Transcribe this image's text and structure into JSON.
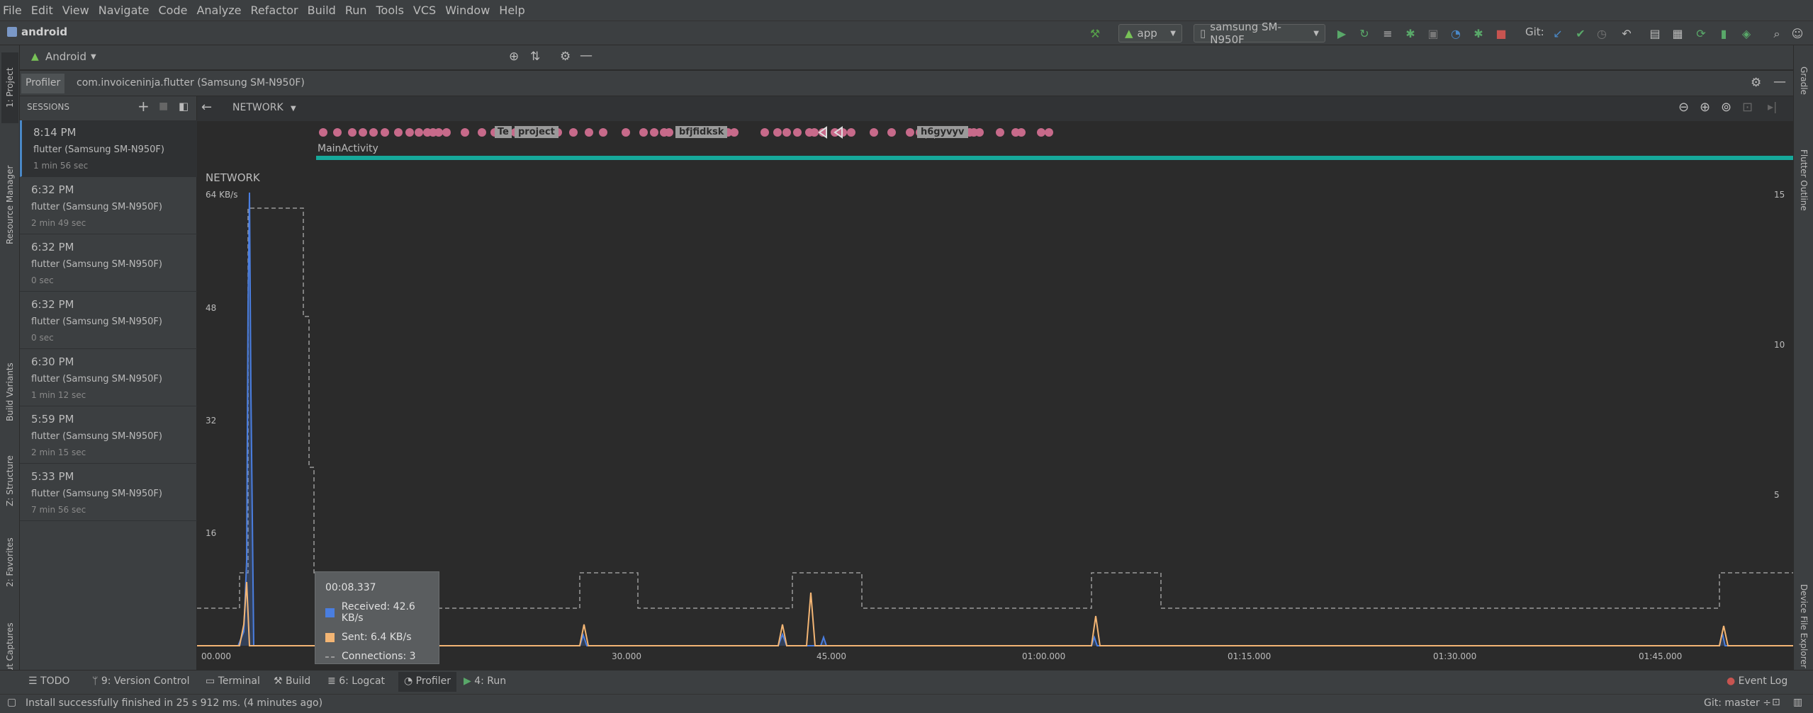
{
  "menu": [
    "File",
    "Edit",
    "View",
    "Navigate",
    "Code",
    "Analyze",
    "Refactor",
    "Build",
    "Run",
    "Tools",
    "VCS",
    "Window",
    "Help"
  ],
  "toolbar": {
    "project_name": "android",
    "run_config": "app",
    "device": "samsung SM-N950F",
    "git_label": "Git:"
  },
  "project_panel": {
    "selector": "Android"
  },
  "left_tabs": [
    "1: Project",
    "Resource Manager",
    "Build Variants",
    "Z: Structure",
    "2: Favorites",
    "Layout Captures"
  ],
  "right_tabs": [
    "Gradle",
    "Flutter Outline",
    "Device File Explorer"
  ],
  "profiler_tabs": {
    "profiler": "Profiler",
    "process": "com.invoiceninja.flutter (Samsung SM-N950F)"
  },
  "sessions": {
    "header": "SESSIONS",
    "items": [
      {
        "time": "8:14 PM",
        "device": "flutter (Samsung SM-N950F)",
        "length": "1 min 56 sec"
      },
      {
        "time": "6:32 PM",
        "device": "flutter (Samsung SM-N950F)",
        "length": "2 min 49 sec"
      },
      {
        "time": "6:32 PM",
        "device": "flutter (Samsung SM-N950F)",
        "length": "0 sec"
      },
      {
        "time": "6:32 PM",
        "device": "flutter (Samsung SM-N950F)",
        "length": "0 sec"
      },
      {
        "time": "6:30 PM",
        "device": "flutter (Samsung SM-N950F)",
        "length": "1 min 12 sec"
      },
      {
        "time": "5:59 PM",
        "device": "flutter (Samsung SM-N950F)",
        "length": "2 min 15 sec"
      },
      {
        "time": "5:33 PM",
        "device": "flutter (Samsung SM-N950F)",
        "length": "7 min 56 sec"
      }
    ]
  },
  "network": {
    "selector": "NETWORK",
    "title": "NETWORK",
    "activity": "MainActivity",
    "event_tags": [
      "Te",
      "project",
      "bfjfidksk",
      "h6gyvyv"
    ],
    "y_left_ticks": [
      "64 KB/s",
      "48",
      "32",
      "16"
    ],
    "y_right_ticks": [
      "15",
      "10",
      "5"
    ],
    "x_ticks": [
      "00.000",
      "30.000",
      "45.000",
      "01:00.000",
      "01:15.000",
      "01:30.000",
      "01:45.000"
    ]
  },
  "tooltip": {
    "time": "00:08.337",
    "received": "Received: 42.6 KB/s",
    "sent": "Sent: 6.4 KB/s",
    "connections": "Connections: 3"
  },
  "bottom_tabs": [
    "TODO",
    "9: Version Control",
    "Terminal",
    "Build",
    "6: Logcat",
    "Profiler",
    "4: Run",
    "Event Log"
  ],
  "status": {
    "message": "Install successfully finished in 25 s 912 ms. (4 minutes ago)",
    "git_branch": "Git: master ÷"
  },
  "colors": {
    "received": "#4a7ee0",
    "sent": "#f3b574",
    "connections": "#9a9a9a",
    "activity": "#16a89a",
    "event": "#c76a8a"
  }
}
